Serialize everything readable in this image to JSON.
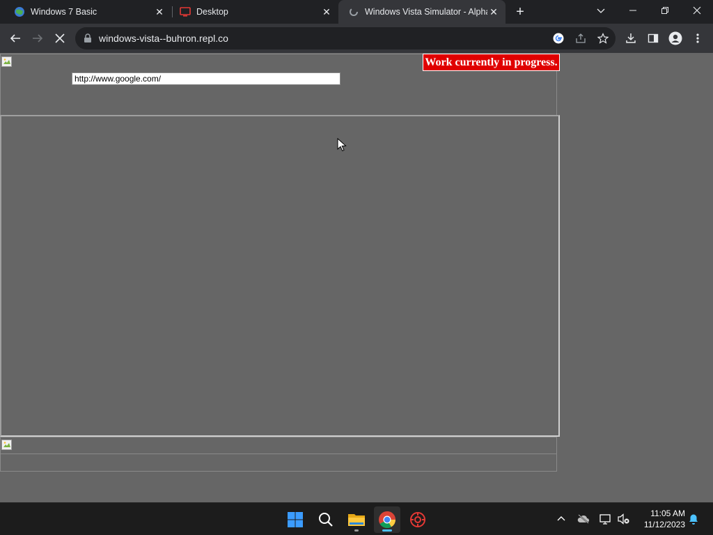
{
  "browser": {
    "tabs": [
      {
        "title": "Windows 7 Basic",
        "icon": "globe-favicon",
        "active": false
      },
      {
        "title": "Desktop",
        "icon": "monitor-favicon",
        "active": false
      },
      {
        "title": "Windows Vista Simulator - Alpha",
        "icon": "loading-favicon",
        "active": true
      }
    ],
    "url": "windows-vista--buhron.repl.co"
  },
  "page": {
    "address_value": "http://www.google.com/",
    "wip_badge": "Work currently in progress."
  },
  "taskbar": {
    "apps": [
      "start-icon",
      "search-icon",
      "file-explorer-icon",
      "chrome-icon",
      "app-icon"
    ],
    "time": "11:05 AM",
    "date": "11/12/2023"
  },
  "colors": {
    "page_bg": "#666666",
    "badge_bg": "#e00000",
    "tab_active": "#35363a",
    "tabstrip": "#202124"
  }
}
